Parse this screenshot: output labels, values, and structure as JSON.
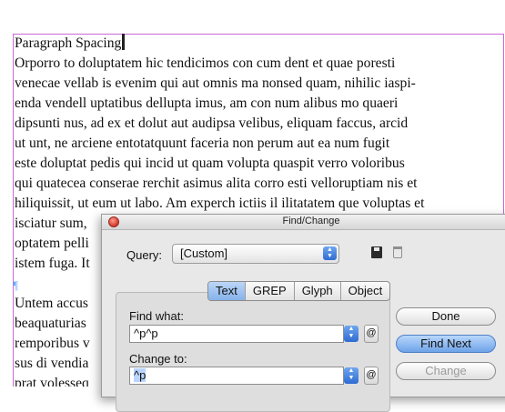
{
  "document": {
    "lines": [
      "Paragraph Spacing",
      "Orporro to doluptatem hic tendicimos con cum dent et quae poresti",
      "venecae vellab is evenim qui aut omnis ma nonsed quam, nihilic iaspi-",
      "enda vendell uptatibus dellupta imus, am con num alibus mo quaeri",
      "dipsunti nus, ad ex et dolut aut audipsa velibus, eliquam faccus, arcid",
      "ut unt, ne arciene entotatquunt faceria non perum aut ea num fugit",
      "este doluptat pedis qui incid ut quam volupta quaspit verro voloribus",
      "qui quatecea conserae rerchit asimus alita corro esti velloruptiam nis et",
      "hiliquissit, ut eum ut labo. Am experch ictiis il ilitatatem que voluptas et",
      "isciatur sum,",
      "optatem pelli",
      "istem fuga. It",
      "",
      "Untem accus",
      "beaquaturias",
      "remporibus v",
      "sus di vendia",
      "prat volesseq"
    ]
  },
  "dialog": {
    "title": "Find/Change",
    "query_label": "Query:",
    "query_value": "[Custom]",
    "tabs": [
      "Text",
      "GREP",
      "Glyph",
      "Object"
    ],
    "active_tab": "Text",
    "find_label": "Find what:",
    "find_value": "^p^p",
    "change_label": "Change to:",
    "change_value": "^p",
    "at_symbol": "@",
    "buttons": {
      "done": "Done",
      "find_next": "Find Next",
      "change": "Change"
    }
  }
}
